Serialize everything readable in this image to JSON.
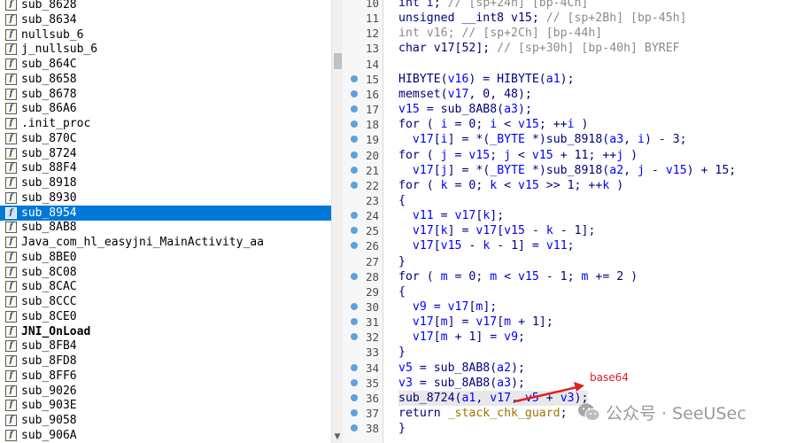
{
  "function_list": [
    {
      "name": "sub_8628"
    },
    {
      "name": "sub_8634"
    },
    {
      "name": "nullsub_6"
    },
    {
      "name": "j_nullsub_6"
    },
    {
      "name": "sub_864C"
    },
    {
      "name": "sub_8658"
    },
    {
      "name": "sub_8678"
    },
    {
      "name": "sub_86A6"
    },
    {
      "name": ".init_proc"
    },
    {
      "name": "sub_870C"
    },
    {
      "name": "sub_8724"
    },
    {
      "name": "sub_88F4"
    },
    {
      "name": "sub_8918"
    },
    {
      "name": "sub_8930"
    },
    {
      "name": "sub_8954",
      "selected": true
    },
    {
      "name": "sub_8AB8"
    },
    {
      "name": "Java_com_hl_easyjni_MainActivity_aa"
    },
    {
      "name": "sub_8BE0"
    },
    {
      "name": "sub_8C08"
    },
    {
      "name": "sub_8CAC"
    },
    {
      "name": "sub_8CCC"
    },
    {
      "name": "sub_8CE0"
    },
    {
      "name": "JNI_OnLoad",
      "bold": true
    },
    {
      "name": "sub_8FB4"
    },
    {
      "name": "sub_8FD8"
    },
    {
      "name": "sub_8FF6"
    },
    {
      "name": "sub_9026"
    },
    {
      "name": "sub_903E"
    },
    {
      "name": "sub_9058"
    },
    {
      "name": "sub_906A"
    }
  ],
  "code_lines": [
    {
      "no": "10",
      "bp": false,
      "html": "int i; <span class='cmt'>// [sp+24h] [bp-4Ch]</span>"
    },
    {
      "no": "11",
      "bp": false,
      "html": "unsigned __int8 v15; <span class='cmt'>// [sp+2Bh] [bp-45h]</span>"
    },
    {
      "no": "12",
      "bp": false,
      "html": "<span class='cmt'>int v16; // [sp+2Ch] [bp-44h]</span>"
    },
    {
      "no": "13",
      "bp": false,
      "html": "char v17[52]; <span class='cmt'>// [sp+30h] [bp-40h] BYREF</span>"
    },
    {
      "no": "14",
      "bp": false,
      "html": ""
    },
    {
      "no": "15",
      "bp": true,
      "html": "HIBYTE(<span class='var'>v16</span>) = HIBYTE(<span class='var'>a1</span>);"
    },
    {
      "no": "16",
      "bp": true,
      "html": "memset(<span class='var'>v17</span>, 0, 48);"
    },
    {
      "no": "17",
      "bp": true,
      "html": "<span class='var'>v15</span> = sub_8AB8(<span class='var'>a3</span>);"
    },
    {
      "no": "18",
      "bp": true,
      "html": "for ( <span class='var'>i</span> = 0; <span class='var'>i</span> &lt; <span class='var'>v15</span>; ++<span class='var'>i</span> )"
    },
    {
      "no": "19",
      "bp": true,
      "html": "  <span class='var'>v17</span>[<span class='var'>i</span>] = *(<span class='var'>_BYTE</span> *)sub_8918(<span class='var'>a3</span>, <span class='var'>i</span>) - 3;"
    },
    {
      "no": "20",
      "bp": true,
      "html": "for ( <span class='var'>j</span> = <span class='var'>v15</span>; <span class='var'>j</span> &lt; <span class='var'>v15</span> + 11; ++<span class='var'>j</span> )"
    },
    {
      "no": "21",
      "bp": true,
      "html": "  <span class='var'>v17</span>[<span class='var'>j</span>] = *(<span class='var'>_BYTE</span> *)sub_8918(<span class='var'>a2</span>, <span class='var'>j</span> - <span class='var'>v15</span>) + 15;"
    },
    {
      "no": "22",
      "bp": true,
      "html": "for ( <span class='var'>k</span> = 0; <span class='var'>k</span> &lt; <span class='var'>v15</span> &gt;&gt; 1; ++<span class='var'>k</span> )"
    },
    {
      "no": "23",
      "bp": false,
      "html": "{"
    },
    {
      "no": "24",
      "bp": true,
      "html": "  <span class='var'>v11</span> = <span class='var'>v17</span>[<span class='var'>k</span>];"
    },
    {
      "no": "25",
      "bp": true,
      "html": "  <span class='var'>v17</span>[<span class='var'>k</span>] = <span class='var'>v17</span>[<span class='var'>v15</span> - <span class='var'>k</span> - 1];"
    },
    {
      "no": "26",
      "bp": true,
      "html": "  <span class='var'>v17</span>[<span class='var'>v15</span> - <span class='var'>k</span> - 1] = <span class='var'>v11</span>;"
    },
    {
      "no": "27",
      "bp": false,
      "html": "}"
    },
    {
      "no": "28",
      "bp": true,
      "html": "for ( <span class='var'>m</span> = 0; <span class='var'>m</span> &lt; <span class='var'>v15</span> - 1; <span class='var'>m</span> += 2 )"
    },
    {
      "no": "29",
      "bp": false,
      "html": "{"
    },
    {
      "no": "30",
      "bp": true,
      "html": "  <span class='var'>v9</span> = <span class='var'>v17</span>[<span class='var'>m</span>];"
    },
    {
      "no": "31",
      "bp": true,
      "html": "  <span class='var'>v17</span>[<span class='var'>m</span>] = <span class='var'>v17</span>[<span class='var'>m</span> + 1];"
    },
    {
      "no": "32",
      "bp": true,
      "html": "  <span class='var'>v17</span>[<span class='var'>m</span> + 1] = <span class='var'>v9</span>;"
    },
    {
      "no": "33",
      "bp": false,
      "html": "}"
    },
    {
      "no": "34",
      "bp": true,
      "html": "<span class='var'>v5</span> = sub_8AB8(<span class='var'>a2</span>);"
    },
    {
      "no": "35",
      "bp": true,
      "html": "<span class='var'>v3</span> = sub_8AB8(<span class='var'>a3</span>);"
    },
    {
      "no": "36",
      "bp": true,
      "highlight": true,
      "html": "sub_8724(<span class='var'>a1</span>, <span class='var'>v17</span>, <span class='var'>v5</span> + <span class='var'>v3</span>);"
    },
    {
      "no": "37",
      "bp": true,
      "html": "return <span class='ylw'>_stack_chk_guard</span>;"
    },
    {
      "no": "38",
      "bp": true,
      "html": "<span class='plain'>}</span>"
    }
  ],
  "annotation": {
    "label": "base64"
  },
  "watermark": {
    "text": "公众号 · SeeUSec",
    "logo": "wechat-logo-icon"
  },
  "colors": {
    "selection": "#0078d7",
    "breakpoint_dot": "#5ba3e0",
    "annotation": "#e02020",
    "code_text": "#000080",
    "variable": "#0000ff",
    "comment": "#8a8a8a"
  }
}
